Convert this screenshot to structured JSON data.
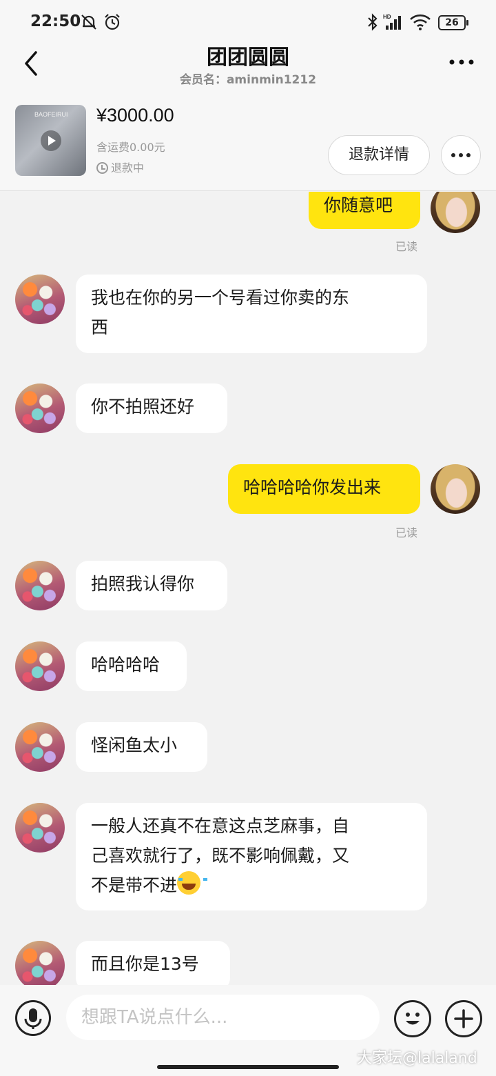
{
  "status_bar": {
    "time": "22:50",
    "battery": "26"
  },
  "header": {
    "title": "团团圆圆",
    "subtitle": "会员名：aminmin1212"
  },
  "product": {
    "brand_mark": "BAOFEIRUI",
    "price": "¥3000.00",
    "shipping": "含运费0.00元",
    "status": "退款中",
    "refund_button": "退款详情"
  },
  "messages": [
    {
      "side": "out",
      "text": "你随意吧",
      "read": "已读"
    },
    {
      "side": "in",
      "line1": "我也在你的另一个号看过你卖的东",
      "line2": "西"
    },
    {
      "side": "in",
      "text": "你不拍照还好"
    },
    {
      "side": "out",
      "text": "哈哈哈哈你发出来",
      "read": "已读"
    },
    {
      "side": "in",
      "text": "拍照我认得你"
    },
    {
      "side": "in",
      "text": "哈哈哈哈"
    },
    {
      "side": "in",
      "text": "怪闲鱼太小"
    },
    {
      "side": "in",
      "line1": "一般人还真不在意这点芝麻事，自",
      "line2": "己喜欢就行了，既不影响佩戴，又",
      "line3": "不是带不进"
    },
    {
      "side": "in",
      "text": "而且你是13号"
    }
  ],
  "input": {
    "placeholder": "想跟TA说点什么..."
  },
  "watermark": "大家坛@lalaland",
  "colors": {
    "outgoing_bubble": "#ffe40f",
    "incoming_bubble": "#ffffff",
    "background": "#f2f2f2"
  }
}
